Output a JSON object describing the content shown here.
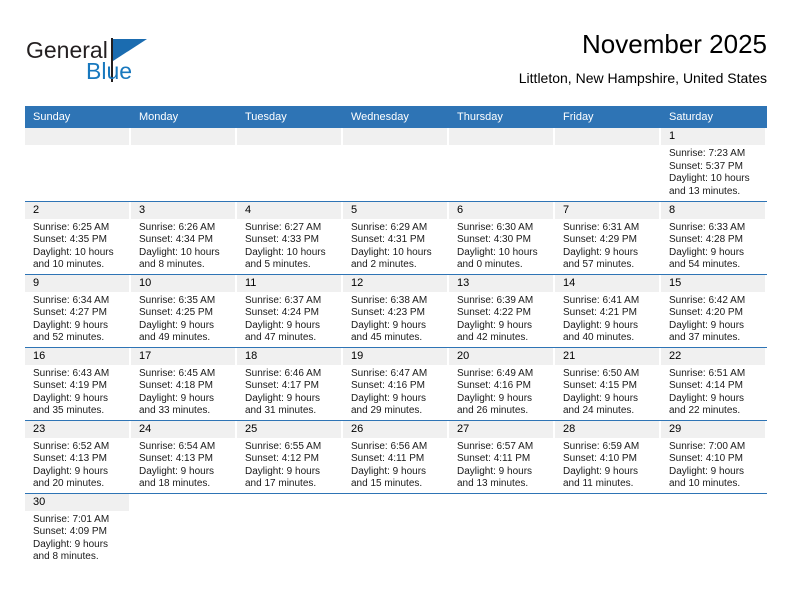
{
  "brand": {
    "name_part1": "General",
    "name_part2": "Blue"
  },
  "header": {
    "title": "November 2025",
    "location": "Littleton, New Hampshire, United States"
  },
  "weekday_headers": [
    "Sunday",
    "Monday",
    "Tuesday",
    "Wednesday",
    "Thursday",
    "Friday",
    "Saturday"
  ],
  "colors": {
    "header_blue": "#2e74b5",
    "brand_blue": "#1878be",
    "daynum_band": "#f0f0f0"
  },
  "weeks": [
    [
      {
        "type": "empty"
      },
      {
        "type": "empty"
      },
      {
        "type": "empty"
      },
      {
        "type": "empty"
      },
      {
        "type": "empty"
      },
      {
        "type": "empty"
      },
      {
        "type": "day",
        "day": "1",
        "sunrise": "Sunrise: 7:23 AM",
        "sunset": "Sunset: 5:37 PM",
        "daylight1": "Daylight: 10 hours",
        "daylight2": "and 13 minutes."
      }
    ],
    [
      {
        "type": "day",
        "day": "2",
        "sunrise": "Sunrise: 6:25 AM",
        "sunset": "Sunset: 4:35 PM",
        "daylight1": "Daylight: 10 hours",
        "daylight2": "and 10 minutes."
      },
      {
        "type": "day",
        "day": "3",
        "sunrise": "Sunrise: 6:26 AM",
        "sunset": "Sunset: 4:34 PM",
        "daylight1": "Daylight: 10 hours",
        "daylight2": "and 8 minutes."
      },
      {
        "type": "day",
        "day": "4",
        "sunrise": "Sunrise: 6:27 AM",
        "sunset": "Sunset: 4:33 PM",
        "daylight1": "Daylight: 10 hours",
        "daylight2": "and 5 minutes."
      },
      {
        "type": "day",
        "day": "5",
        "sunrise": "Sunrise: 6:29 AM",
        "sunset": "Sunset: 4:31 PM",
        "daylight1": "Daylight: 10 hours",
        "daylight2": "and 2 minutes."
      },
      {
        "type": "day",
        "day": "6",
        "sunrise": "Sunrise: 6:30 AM",
        "sunset": "Sunset: 4:30 PM",
        "daylight1": "Daylight: 10 hours",
        "daylight2": "and 0 minutes."
      },
      {
        "type": "day",
        "day": "7",
        "sunrise": "Sunrise: 6:31 AM",
        "sunset": "Sunset: 4:29 PM",
        "daylight1": "Daylight: 9 hours",
        "daylight2": "and 57 minutes."
      },
      {
        "type": "day",
        "day": "8",
        "sunrise": "Sunrise: 6:33 AM",
        "sunset": "Sunset: 4:28 PM",
        "daylight1": "Daylight: 9 hours",
        "daylight2": "and 54 minutes."
      }
    ],
    [
      {
        "type": "day",
        "day": "9",
        "sunrise": "Sunrise: 6:34 AM",
        "sunset": "Sunset: 4:27 PM",
        "daylight1": "Daylight: 9 hours",
        "daylight2": "and 52 minutes."
      },
      {
        "type": "day",
        "day": "10",
        "sunrise": "Sunrise: 6:35 AM",
        "sunset": "Sunset: 4:25 PM",
        "daylight1": "Daylight: 9 hours",
        "daylight2": "and 49 minutes."
      },
      {
        "type": "day",
        "day": "11",
        "sunrise": "Sunrise: 6:37 AM",
        "sunset": "Sunset: 4:24 PM",
        "daylight1": "Daylight: 9 hours",
        "daylight2": "and 47 minutes."
      },
      {
        "type": "day",
        "day": "12",
        "sunrise": "Sunrise: 6:38 AM",
        "sunset": "Sunset: 4:23 PM",
        "daylight1": "Daylight: 9 hours",
        "daylight2": "and 45 minutes."
      },
      {
        "type": "day",
        "day": "13",
        "sunrise": "Sunrise: 6:39 AM",
        "sunset": "Sunset: 4:22 PM",
        "daylight1": "Daylight: 9 hours",
        "daylight2": "and 42 minutes."
      },
      {
        "type": "day",
        "day": "14",
        "sunrise": "Sunrise: 6:41 AM",
        "sunset": "Sunset: 4:21 PM",
        "daylight1": "Daylight: 9 hours",
        "daylight2": "and 40 minutes."
      },
      {
        "type": "day",
        "day": "15",
        "sunrise": "Sunrise: 6:42 AM",
        "sunset": "Sunset: 4:20 PM",
        "daylight1": "Daylight: 9 hours",
        "daylight2": "and 37 minutes."
      }
    ],
    [
      {
        "type": "day",
        "day": "16",
        "sunrise": "Sunrise: 6:43 AM",
        "sunset": "Sunset: 4:19 PM",
        "daylight1": "Daylight: 9 hours",
        "daylight2": "and 35 minutes."
      },
      {
        "type": "day",
        "day": "17",
        "sunrise": "Sunrise: 6:45 AM",
        "sunset": "Sunset: 4:18 PM",
        "daylight1": "Daylight: 9 hours",
        "daylight2": "and 33 minutes."
      },
      {
        "type": "day",
        "day": "18",
        "sunrise": "Sunrise: 6:46 AM",
        "sunset": "Sunset: 4:17 PM",
        "daylight1": "Daylight: 9 hours",
        "daylight2": "and 31 minutes."
      },
      {
        "type": "day",
        "day": "19",
        "sunrise": "Sunrise: 6:47 AM",
        "sunset": "Sunset: 4:16 PM",
        "daylight1": "Daylight: 9 hours",
        "daylight2": "and 29 minutes."
      },
      {
        "type": "day",
        "day": "20",
        "sunrise": "Sunrise: 6:49 AM",
        "sunset": "Sunset: 4:16 PM",
        "daylight1": "Daylight: 9 hours",
        "daylight2": "and 26 minutes."
      },
      {
        "type": "day",
        "day": "21",
        "sunrise": "Sunrise: 6:50 AM",
        "sunset": "Sunset: 4:15 PM",
        "daylight1": "Daylight: 9 hours",
        "daylight2": "and 24 minutes."
      },
      {
        "type": "day",
        "day": "22",
        "sunrise": "Sunrise: 6:51 AM",
        "sunset": "Sunset: 4:14 PM",
        "daylight1": "Daylight: 9 hours",
        "daylight2": "and 22 minutes."
      }
    ],
    [
      {
        "type": "day",
        "day": "23",
        "sunrise": "Sunrise: 6:52 AM",
        "sunset": "Sunset: 4:13 PM",
        "daylight1": "Daylight: 9 hours",
        "daylight2": "and 20 minutes."
      },
      {
        "type": "day",
        "day": "24",
        "sunrise": "Sunrise: 6:54 AM",
        "sunset": "Sunset: 4:13 PM",
        "daylight1": "Daylight: 9 hours",
        "daylight2": "and 18 minutes."
      },
      {
        "type": "day",
        "day": "25",
        "sunrise": "Sunrise: 6:55 AM",
        "sunset": "Sunset: 4:12 PM",
        "daylight1": "Daylight: 9 hours",
        "daylight2": "and 17 minutes."
      },
      {
        "type": "day",
        "day": "26",
        "sunrise": "Sunrise: 6:56 AM",
        "sunset": "Sunset: 4:11 PM",
        "daylight1": "Daylight: 9 hours",
        "daylight2": "and 15 minutes."
      },
      {
        "type": "day",
        "day": "27",
        "sunrise": "Sunrise: 6:57 AM",
        "sunset": "Sunset: 4:11 PM",
        "daylight1": "Daylight: 9 hours",
        "daylight2": "and 13 minutes."
      },
      {
        "type": "day",
        "day": "28",
        "sunrise": "Sunrise: 6:59 AM",
        "sunset": "Sunset: 4:10 PM",
        "daylight1": "Daylight: 9 hours",
        "daylight2": "and 11 minutes."
      },
      {
        "type": "day",
        "day": "29",
        "sunrise": "Sunrise: 7:00 AM",
        "sunset": "Sunset: 4:10 PM",
        "daylight1": "Daylight: 9 hours",
        "daylight2": "and 10 minutes."
      }
    ],
    [
      {
        "type": "day",
        "day": "30",
        "sunrise": "Sunrise: 7:01 AM",
        "sunset": "Sunset: 4:09 PM",
        "daylight1": "Daylight: 9 hours",
        "daylight2": "and 8 minutes."
      },
      {
        "type": "blank"
      },
      {
        "type": "blank"
      },
      {
        "type": "blank"
      },
      {
        "type": "blank"
      },
      {
        "type": "blank"
      },
      {
        "type": "blank"
      }
    ]
  ]
}
